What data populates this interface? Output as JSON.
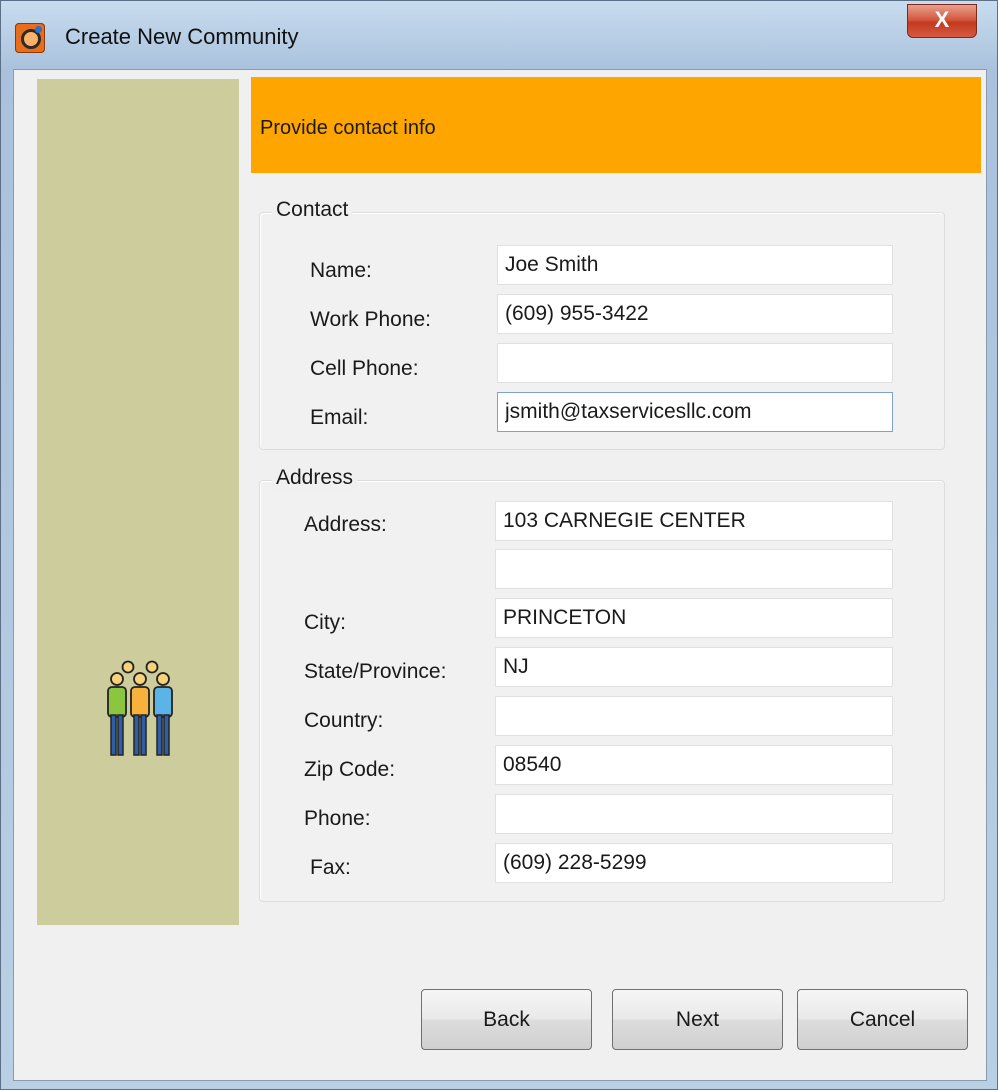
{
  "window": {
    "title": "Create New Community",
    "close_label": "X"
  },
  "header": {
    "text": "Provide contact info",
    "color": "#ffa500"
  },
  "side_panel": {
    "color": "#cdcc9c",
    "icon": "people-group-icon"
  },
  "contact": {
    "title": "Contact",
    "name_label": "Name:",
    "name_value": "Joe Smith",
    "work_phone_label": "Work Phone:",
    "work_phone_value": "(609) 955-3422",
    "cell_phone_label": "Cell Phone:",
    "cell_phone_value": "",
    "email_label": "Email:",
    "email_value": "jsmith@taxservicesllc.com"
  },
  "address": {
    "title": "Address",
    "address_label": "Address:",
    "address1_value": "103 CARNEGIE CENTER",
    "address2_value": "",
    "city_label": "City:",
    "city_value": "PRINCETON",
    "state_label": "State/Province:",
    "state_value": "NJ",
    "country_label": "Country:",
    "country_value": "",
    "zip_label": "Zip Code:",
    "zip_value": "08540",
    "phone_label": "Phone:",
    "phone_value": "",
    "fax_label": "Fax:",
    "fax_value": "(609) 228-5299"
  },
  "buttons": {
    "back": "Back",
    "next": "Next",
    "cancel": "Cancel"
  }
}
